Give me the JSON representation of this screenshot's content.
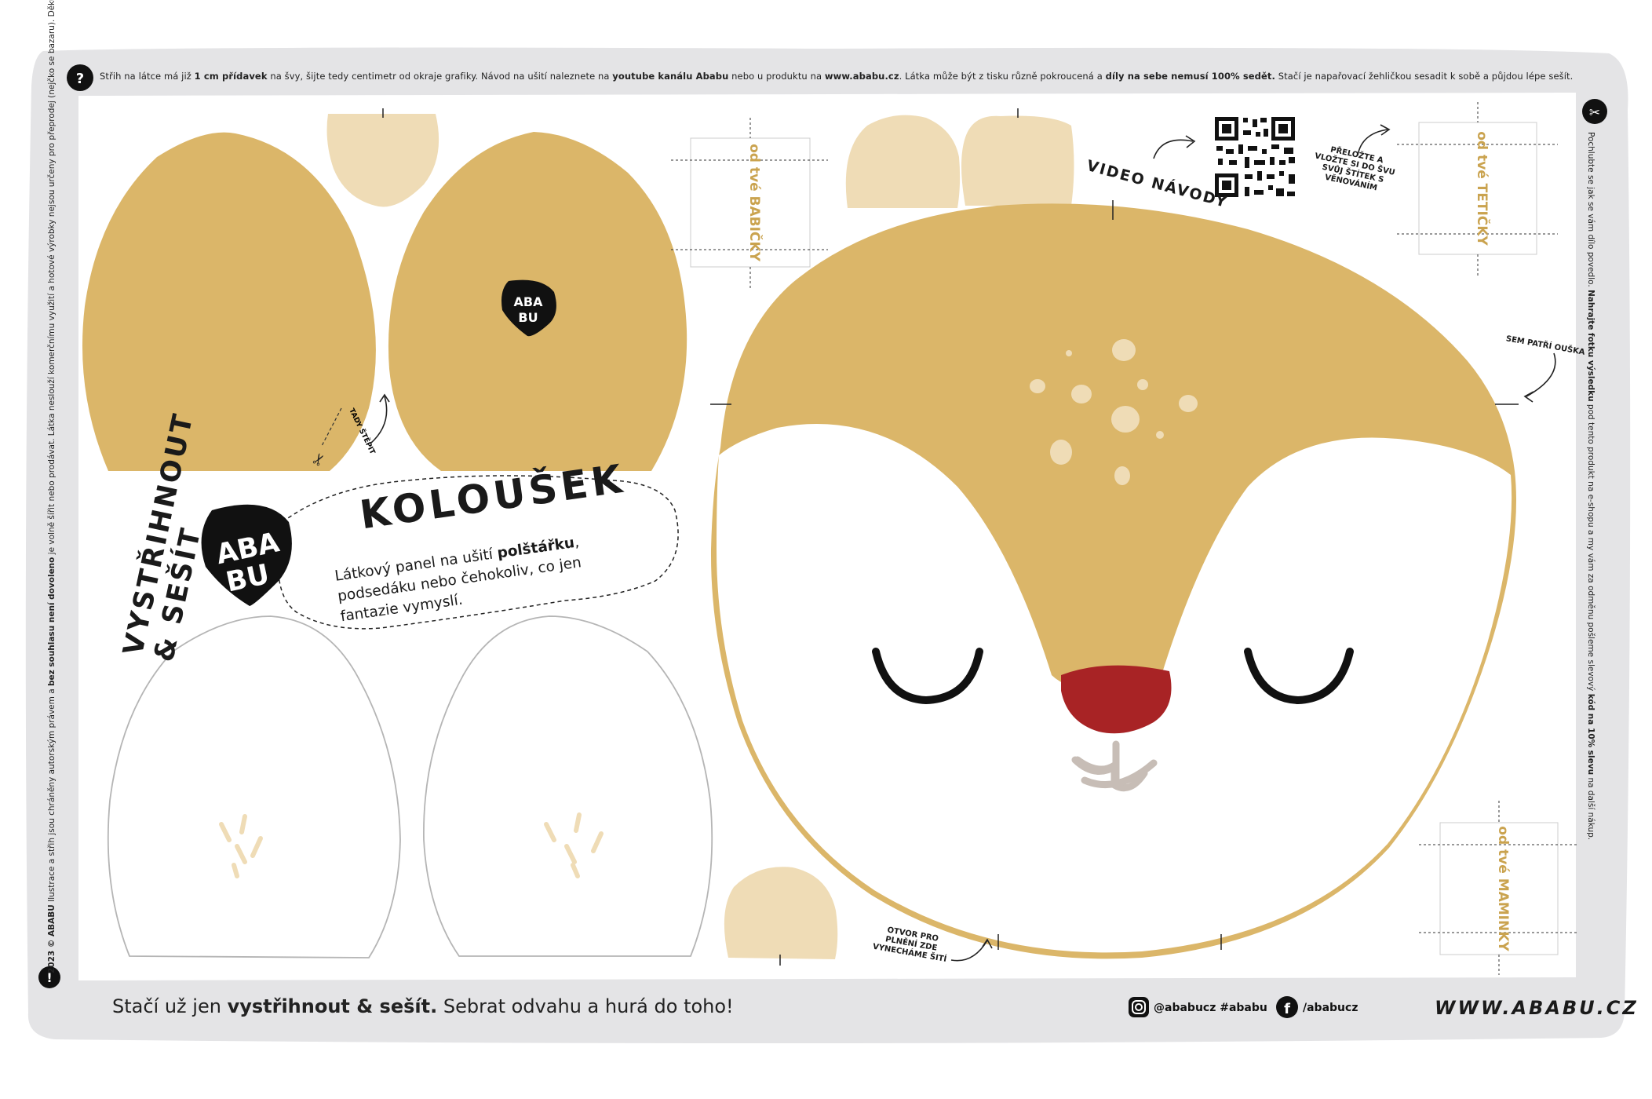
{
  "top_note": {
    "p1": "Střih na látce má již ",
    "b1": "1 cm přídavek",
    "p2": " na švy, šijte tedy centimetr od okraje grafiky. Návod na ušití naleznete na ",
    "b2": "youtube kanálu Ababu",
    "p3": " nebo u produktu na ",
    "b3": "www.ababu.cz",
    "p4": ". Látka může být z tisku různě pokroucená a ",
    "b4": "díly na sebe nemusí 100% sedět.",
    "p5": " Stačí je napařovací žehličkou sesadit k sobě a půjdou lépe sešít."
  },
  "left_note": {
    "b1": "2023 © ABABU",
    "p1": " Ilustrace a střih jsou chráněny autorským právem a ",
    "b2": "bez souhlasu není dovoleno",
    "p2": " je volně šířit nebo prodávat. Látka neslouží komerčnímu využití a hotové výrobky nejsou určeny pro přeprodej (nejčko se bazaru). Děkujeme."
  },
  "right_note": {
    "p1": "Pochlubte se jak se vám dílo povedlo. ",
    "b1": "Nahrajte fotku výsledku",
    "p2": " pod tento produkt na e-shopu a my vám za odměnu pošleme slevový ",
    "b2": "kód na 10% slevu",
    "p3": " na další nákup."
  },
  "icons": {
    "help": "?",
    "scissors": "✂",
    "info": "!"
  },
  "title": "KOLOUŠEK",
  "description": {
    "p1": "Látkový panel na ušití ",
    "b1": "polštářku",
    "p2": ", podsedáku nebo čehokoliv, co jen fantazie vymyslí."
  },
  "cut_and_sew": {
    "line1": "VYSTŘIHNOUT",
    "line2": "& SEŠÍT"
  },
  "logo": {
    "l1": "ABA",
    "l2": "BU"
  },
  "labels": {
    "video": "VIDEO NÁVODY",
    "tag_instructions": "PŘELOŽTE A VLOŽTE SI DO ŠVU SVŮJ ŠTÍTEK S VĚNOVÁNÍM",
    "ears_here": "SEM PATŘÍ OUŠKA",
    "opening": "OTVOR PRO PLNĚNÍ ZDE VYNECHÁME ŠITÍ",
    "cut_here": "TADY ŠTĚPIT",
    "tag1": "od tvé BABIČKY",
    "tag2": "od tvé TETIČKY",
    "tag3": "od tvé MAMINKY"
  },
  "footer": {
    "p1": "Stačí už jen ",
    "b1": "vystřihnout & sešít.",
    "p2": " Sebrat odvahu a hurá do toho!",
    "instagram": "@ababucz  #ababu",
    "facebook": "/ababucz",
    "website": "WWW.ABABU.CZ"
  },
  "colors": {
    "mustard": "#dbb669",
    "cream": "#efdcb6",
    "nose": "#a82325",
    "frame": "#e4e4e6",
    "outline": "#b5b5b5",
    "mouth": "#c7bdb6"
  }
}
